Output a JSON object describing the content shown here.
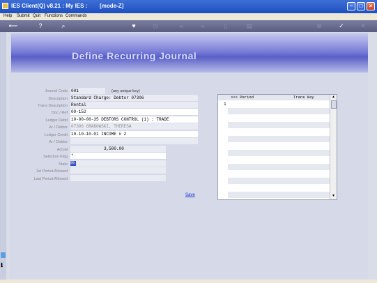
{
  "window": {
    "title": "IES Client(Q) v8.21 : My IES :        [mode-Z]",
    "controls": {
      "minimize": "–",
      "maximize": "□",
      "close": "×"
    }
  },
  "menu": [
    "Help",
    "Submit",
    "Quit",
    "Functions",
    "Commands"
  ],
  "toolbar": {
    "icons": [
      "back-key-icon",
      "help-icon",
      "search-icon",
      "heart-icon",
      "clock-icon",
      "rewind-icon",
      "fast-forward-icon",
      "document-icon",
      "printer-icon",
      "trash-icon",
      "check-icon",
      "close-icon"
    ],
    "glyphs": {
      "back": "⟵",
      "help": "?",
      "search": "⌕",
      "heart": "♥",
      "clock": "◷",
      "rewind": "«",
      "forward": "»",
      "doc": "▯",
      "print": "▤",
      "trash": "⊘",
      "check": "✓",
      "close": "✕"
    }
  },
  "header": {
    "title": "Define Recurring Journal"
  },
  "form": {
    "labels": {
      "journal_code": "Journal Code",
      "description": "Description",
      "trans_description": "Trans Description",
      "doc_ref": "Doc / Ref",
      "ledger_debit": "Ledger Debit",
      "ar_debtor": "Ar / Debtor",
      "ledger_credit": "Ledger Credit",
      "ar_debtor_2": "Ar / Debtor",
      "actual": "Actual",
      "selection_flag": "Selection Flag",
      "state": "State",
      "first_period_allowed": "1st Period Allowed",
      "last_period_allowed": "Last Period Allowed"
    },
    "values": {
      "journal_code": "001",
      "journal_code_hint": "(any unique key)",
      "description": "Standard Charge: Debtor 07306",
      "trans_description": "Rental",
      "doc_ref": "09-152",
      "ledger_debit": "10-00-00-35 DEBTORS CONTROL (1) : TRADE",
      "ar_debtor": "07306 GRABOWSKI, THERESA",
      "ledger_credit": "10-10-10-01 INCOME # 2",
      "ar_debtor_2": "",
      "actual": "3,500.00",
      "selection_flag": "*",
      "state": "00",
      "first_period_allowed": "",
      "last_period_allowed": ""
    },
    "save_label": "Save"
  },
  "grid": {
    "columns": [
      ">>> Period",
      "Trans Key"
    ],
    "rows": [
      {
        "num": "1",
        "period": "",
        "trans_key": ""
      }
    ],
    "scroll_up": "▲",
    "scroll_down": "▼"
  }
}
